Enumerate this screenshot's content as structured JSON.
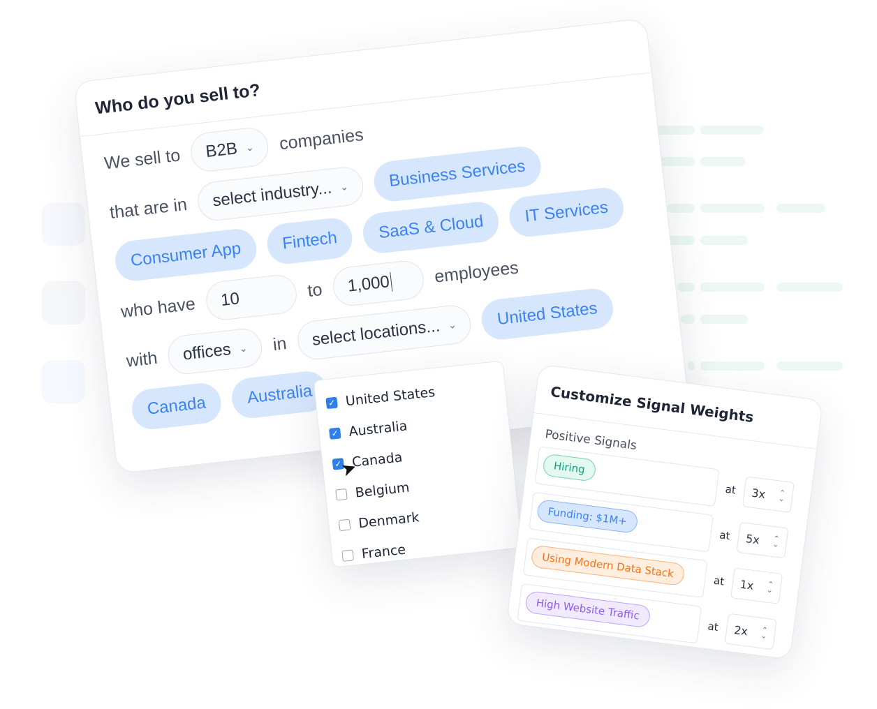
{
  "main_card": {
    "title": "Who do you sell to?",
    "row1": {
      "prefix": "We sell to",
      "type": "B2B",
      "suffix": "companies"
    },
    "row2": {
      "prefix": "that are in",
      "industry_placeholder": "select industry..."
    },
    "industries": [
      "Business Services",
      "Consumer App",
      "Fintech",
      "SaaS & Cloud",
      "IT Services"
    ],
    "row4": {
      "prefix": "who have",
      "min": "10",
      "to": "to",
      "max": "1,000",
      "suffix": "employees"
    },
    "row5": {
      "prefix": "with",
      "presence": "offices",
      "in": "in",
      "location_placeholder": "select locations..."
    },
    "locations": [
      "United States",
      "Canada",
      "Australia"
    ]
  },
  "location_dropdown": {
    "options": [
      {
        "label": "United States",
        "checked": true
      },
      {
        "label": "Australia",
        "checked": true
      },
      {
        "label": "Canada",
        "checked": true
      },
      {
        "label": "Belgium",
        "checked": false
      },
      {
        "label": "Denmark",
        "checked": false
      },
      {
        "label": "France",
        "checked": false
      }
    ]
  },
  "signal_card": {
    "title": "Customize Signal Weights",
    "section": "Positive Signals",
    "at_label": "at",
    "signals": [
      {
        "label": "Hiring",
        "weight": "3x",
        "color": "#10a37f",
        "bg": "#e3f8ef"
      },
      {
        "label": "Funding: $1M+",
        "weight": "5x",
        "color": "#3b82f6",
        "bg": "#d6e7fd"
      },
      {
        "label": "Using Modern Data Stack",
        "weight": "1x",
        "color": "#f97316",
        "bg": "#ffeede"
      },
      {
        "label": "High Website Traffic",
        "weight": "2x",
        "color": "#8b5cf6",
        "bg": "#f1e9fe"
      }
    ]
  },
  "colors": {
    "accent": "#3b82f6",
    "chip_bg": "#d6e7fd",
    "checkbox": "#2f7fe8"
  }
}
